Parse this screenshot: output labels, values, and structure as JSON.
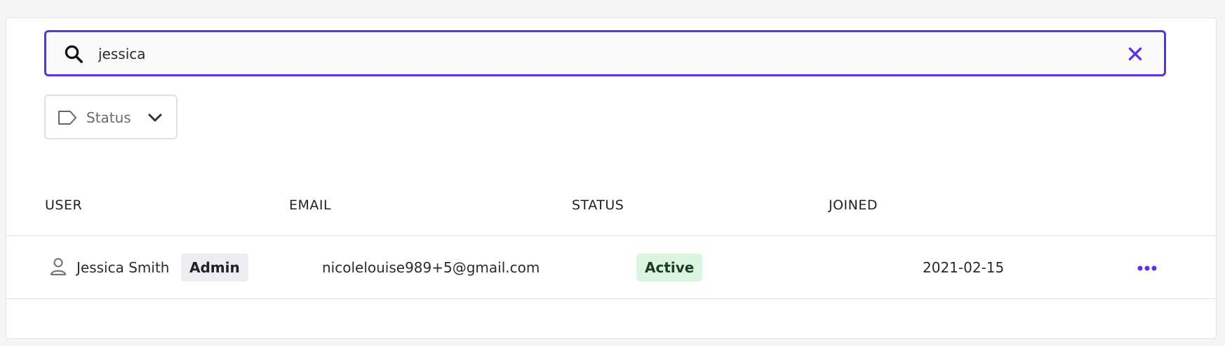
{
  "search": {
    "value": "jessica",
    "icon": "search-icon",
    "clear_icon": "close-icon"
  },
  "filter": {
    "status_label": "Status",
    "icon": "tag-icon",
    "chevron": "chevron-down-icon"
  },
  "table": {
    "columns": [
      "USER",
      "EMAIL",
      "STATUS",
      "JOINED"
    ],
    "rows": [
      {
        "user": "Jessica Smith",
        "role_badge": "Admin",
        "email": "nicolelouise989+5@gmail.com",
        "status": "Active",
        "joined": "2021-02-15"
      }
    ]
  },
  "colors": {
    "accent": "#5a31f4",
    "active_badge_bg": "#dcf5e1",
    "admin_badge_bg": "#ececf1"
  }
}
